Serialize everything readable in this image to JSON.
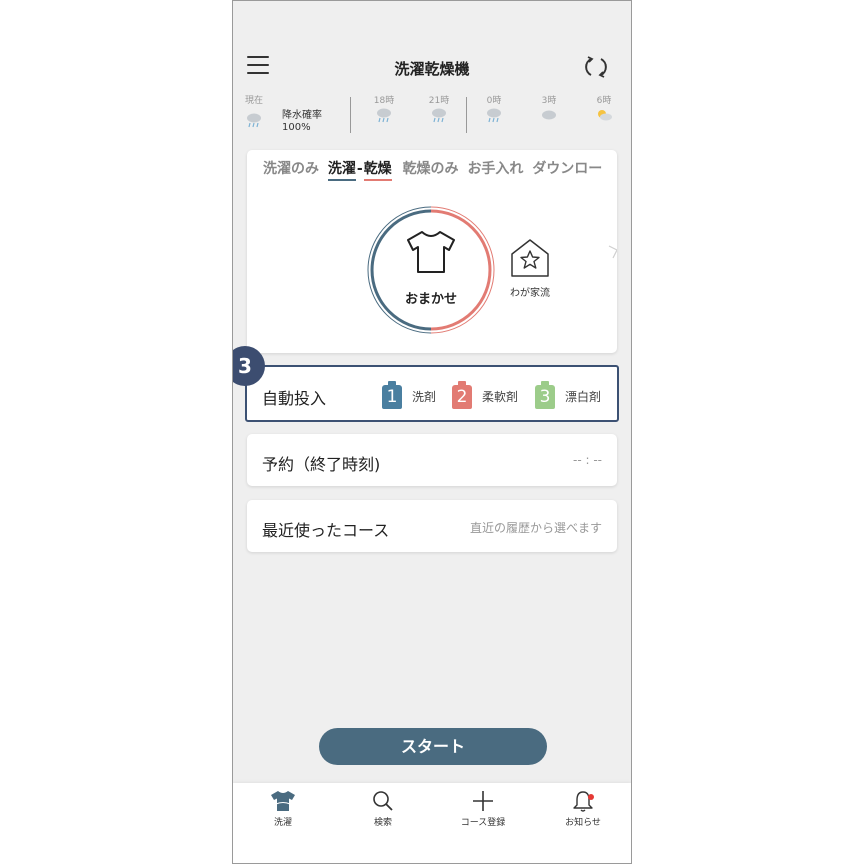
{
  "header": {
    "title": "洗濯乾燥機",
    "menu_icon": "hamburger-menu-icon",
    "refresh_icon": "refresh-icon"
  },
  "weather": {
    "now_label": "現在",
    "rain_label": "降水確率",
    "rain_value": "100%",
    "slots": [
      {
        "time": "18時",
        "icon": "rain-cloud-icon"
      },
      {
        "time": "21時",
        "icon": "rain-cloud-icon"
      },
      {
        "time": "0時",
        "icon": "rain-cloud-icon"
      },
      {
        "time": "3時",
        "icon": "cloud-icon"
      },
      {
        "time": "6時",
        "icon": "sun-cloud-icon"
      }
    ]
  },
  "mode_tabs": {
    "wash_only": "洗濯のみ",
    "wash_dry_wash": "洗濯",
    "wash_dry_sep": "-",
    "wash_dry_dry": "乾燥",
    "dry_only": "乾燥のみ",
    "care": "お手入れ",
    "download": "ダウンロー"
  },
  "courses": {
    "selected_label": "おまかせ",
    "house_label": "わが家流"
  },
  "badge": "3",
  "auto_dose": {
    "label": "自動投入",
    "items": [
      {
        "num": "1",
        "label": "洗剤",
        "color": "#4a7fa0"
      },
      {
        "num": "2",
        "label": "柔軟剤",
        "color": "#e27b73"
      },
      {
        "num": "3",
        "label": "漂白剤",
        "color": "#9ccc8a"
      }
    ]
  },
  "reservation": {
    "label": "予約（終了時刻)",
    "value": "-- : --"
  },
  "recent": {
    "label": "最近使ったコース",
    "hint": "直近の履歴から選べます"
  },
  "start_label": "スタート",
  "tabbar": {
    "wash": "洗濯",
    "search": "検索",
    "add_course": "コース登録",
    "notify": "お知らせ"
  },
  "colors": {
    "accent": "#4a6b80",
    "wash": "#4a6b80",
    "dry": "#e27b73",
    "badge": "#3c4d70"
  }
}
